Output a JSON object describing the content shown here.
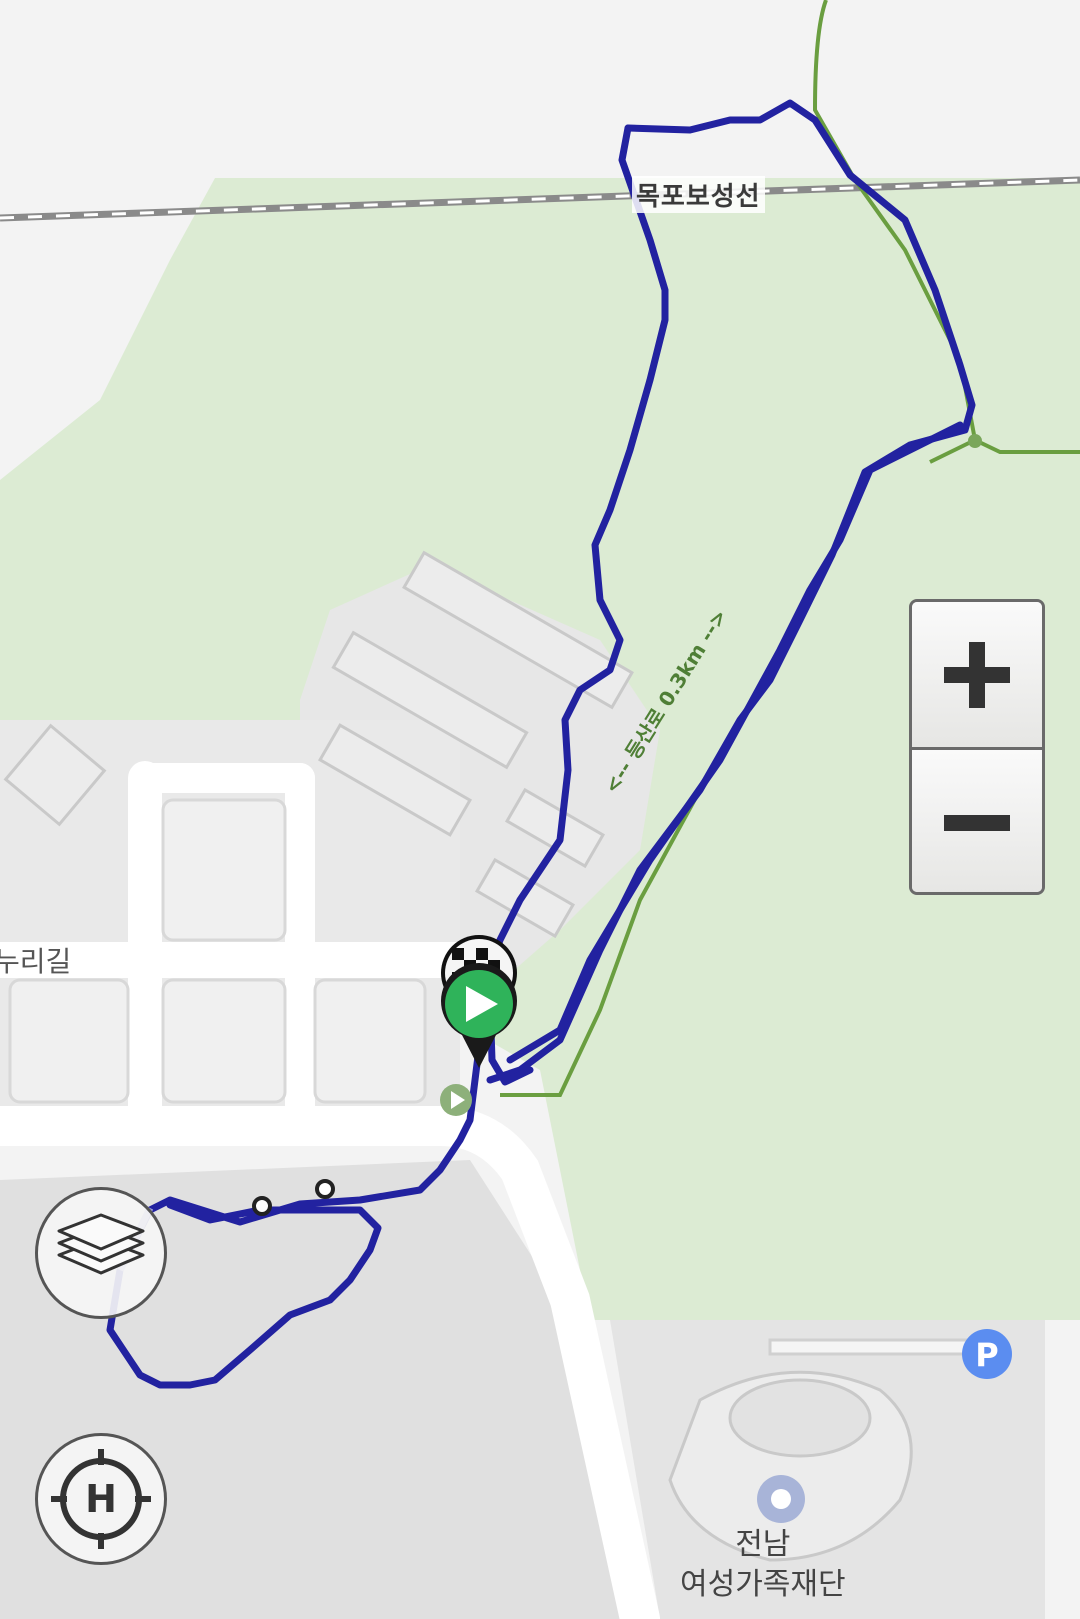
{
  "map": {
    "rail_line_label": "목포보성선",
    "street_label": "누리길",
    "place_label_line1": "전남",
    "place_label_line2": "여성가족재단",
    "trail_label": "<-- 등산로 0.3km -->",
    "route_color": "#2222a0",
    "trail_color": "#6a9e40",
    "park_color": "#dcebd3"
  },
  "controls": {
    "zoom_in_icon": "plus-icon",
    "zoom_out_icon": "minus-icon",
    "layers_icon": "layers-icon",
    "home_icon": "home-crosshair-icon",
    "home_glyph": "H"
  },
  "markers": {
    "start_icon": "play-icon",
    "finish_icon": "checkered-flag-icon",
    "parking_glyph": "P",
    "poi_icon": "place-dot-icon"
  }
}
